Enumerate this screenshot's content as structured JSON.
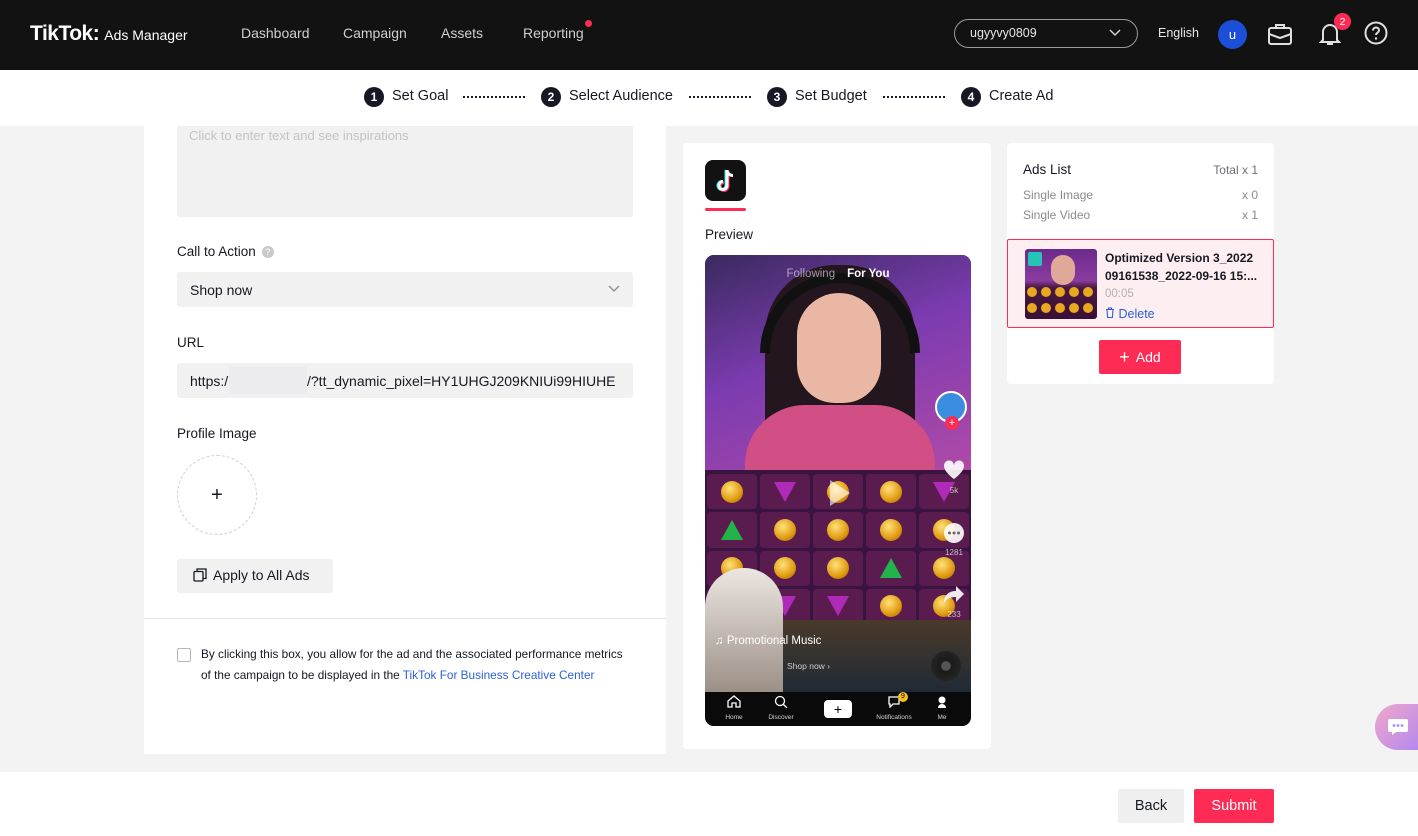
{
  "brand": {
    "logo": "TikTok",
    "colon": ":",
    "product": "Ads Manager"
  },
  "nav": {
    "items": [
      "Dashboard",
      "Campaign",
      "Assets",
      "Reporting"
    ],
    "account": "ugyyvy0809",
    "language": "English",
    "avatar_initial": "u",
    "notification_count": "2",
    "icons": [
      "briefcase-icon",
      "bell-icon",
      "help-icon"
    ]
  },
  "stepper": {
    "steps": [
      {
        "num": "1",
        "label": "Set Goal"
      },
      {
        "num": "2",
        "label": "Select Audience"
      },
      {
        "num": "3",
        "label": "Set Budget"
      },
      {
        "num": "4",
        "label": "Create Ad"
      }
    ]
  },
  "form": {
    "ad_text_placeholder": "Click to enter text and see inspirations",
    "cta_label": "Call to Action",
    "cta_value": "Shop now",
    "url_label": "URL",
    "url_prefix": "https:/",
    "url_suffix": "/?tt_dynamic_pixel=HY1UHGJ209KNIUi99HIUHE",
    "profile_image_label": "Profile Image",
    "upload_symbol": "+",
    "apply_all": "Apply to All Ads",
    "consent_text": "By clicking this box, you allow for the ad and the associated performance metrics of the campaign to be displayed in the ",
    "consent_link": "TikTok For Business Creative Center"
  },
  "preview": {
    "label": "Preview",
    "tab_following": "Following",
    "tab_for_you": "For You",
    "like_count": "5k",
    "comment_count": "1281",
    "share_count": "233",
    "music": "Promotional Music",
    "shop_now": "Shop now",
    "bottom_nav": [
      "Home",
      "Discover",
      "+",
      "Notifications",
      "Me"
    ],
    "notif_badge": "9"
  },
  "ads_list": {
    "title": "Ads List",
    "total": "Total x 1",
    "rows": [
      {
        "label": "Single Image",
        "count": "x 0"
      },
      {
        "label": "Single Video",
        "count": "x 1"
      }
    ],
    "ad": {
      "name": "Optimized Version 3_2022 09161538_2022-09-16 15:...",
      "duration": "00:05",
      "delete": "Delete"
    },
    "add": "Add"
  },
  "footer": {
    "back": "Back",
    "submit": "Submit"
  },
  "colors": {
    "accent": "#fe2c55",
    "link": "#2e5fdb",
    "nav_bg": "#121212"
  }
}
